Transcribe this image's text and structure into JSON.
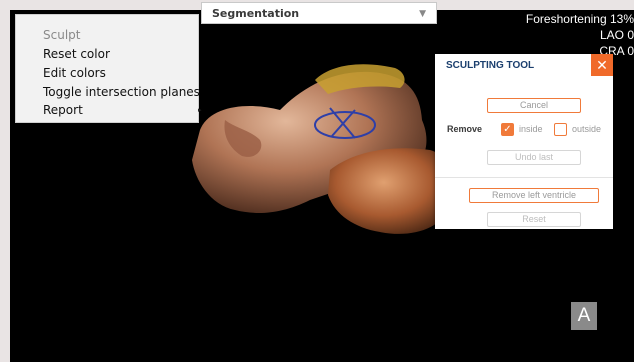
{
  "context_menu": {
    "items": [
      {
        "label": "Sculpt",
        "disabled": true
      },
      {
        "label": "Reset color",
        "disabled": false
      },
      {
        "label": "Edit colors",
        "disabled": false
      },
      {
        "label": "Toggle intersection planes",
        "disabled": false
      },
      {
        "label": "Report",
        "disabled": false,
        "submenu": true
      }
    ],
    "submenu_arrow": "▸"
  },
  "segmentation": {
    "selected": "Segmentation",
    "caret": "▼"
  },
  "overlay": {
    "foreshortening": "Foreshortening 13%",
    "lao": "LAO 0",
    "cra": "CRA 0"
  },
  "sculpting_tool": {
    "title": "SCULPTING TOOL",
    "close_glyph": "✕",
    "cancel": "Cancel",
    "remove_label": "Remove",
    "inside_label": "inside",
    "inside_checked": true,
    "outside_label": "outside",
    "outside_checked": false,
    "check_glyph": "✓",
    "undo_last": "Undo last",
    "remove_left_ventricle": "Remove left ventricle",
    "reset": "Reset"
  },
  "view_orientation": {
    "label": "A"
  },
  "colors": {
    "accent": "#f06a2a",
    "panel_title": "#1b3f6e",
    "viewport_bg": "#000000"
  }
}
